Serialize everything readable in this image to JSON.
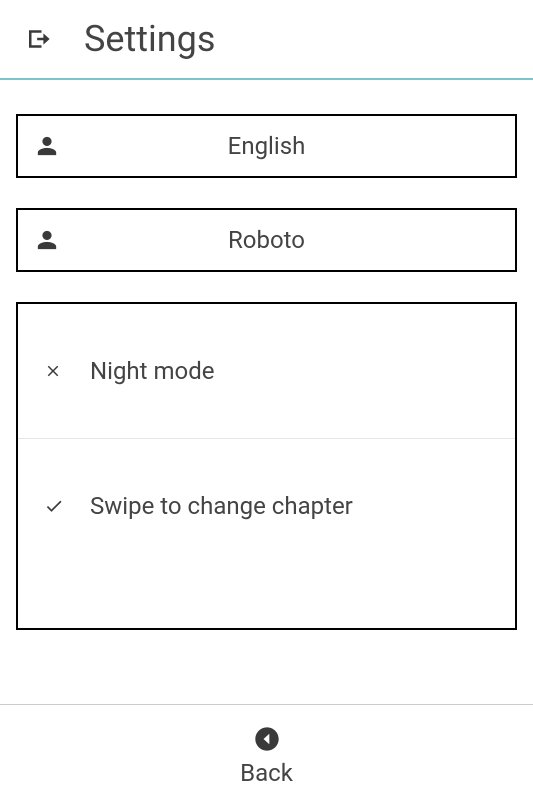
{
  "header": {
    "title": "Settings"
  },
  "options": {
    "language": "English",
    "font": "Roboto"
  },
  "toggles": {
    "night_mode": {
      "label": "Night mode",
      "enabled": false
    },
    "swipe_chapter": {
      "label": "Swipe to change chapter",
      "enabled": true
    }
  },
  "footer": {
    "back": "Back"
  },
  "colors": {
    "accent": "#7bc5cb",
    "icon": "#3a3a3a",
    "text": "#444"
  }
}
